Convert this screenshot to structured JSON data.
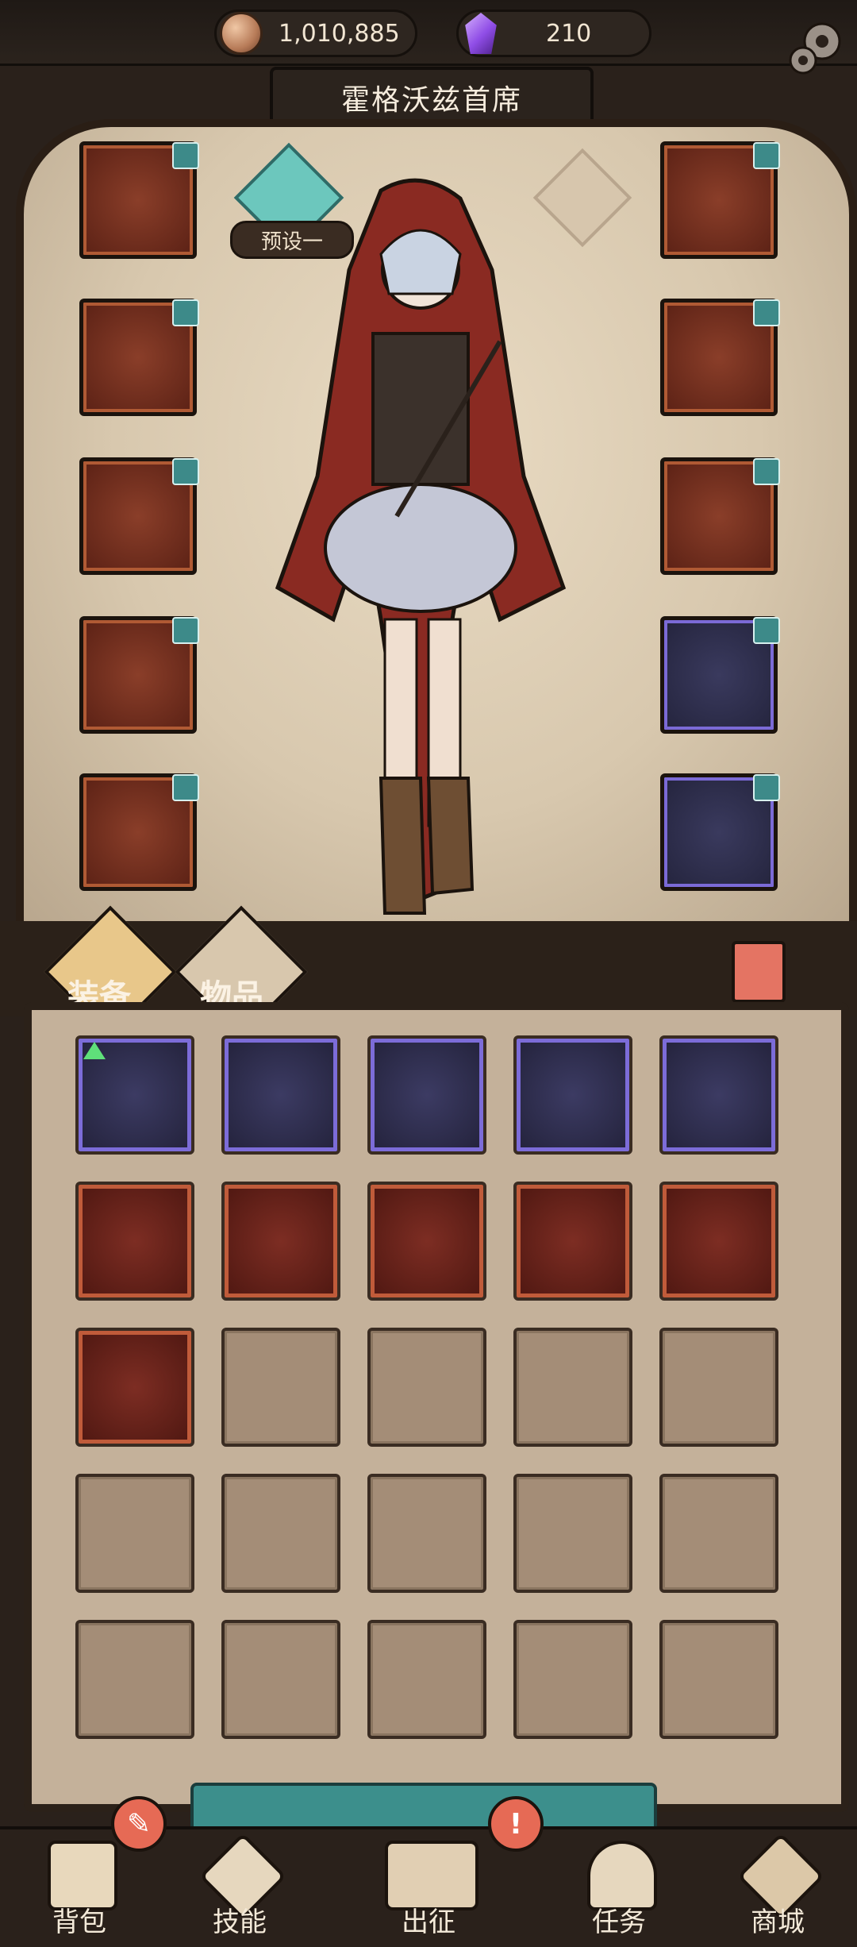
{
  "header": {
    "coins": "1,010,885",
    "gems": "210",
    "title": "霍格沃兹首席",
    "icons": {
      "coin": "coin-icon",
      "gem": "gem-icon",
      "settings": "gear-icon"
    }
  },
  "character": {
    "preset_label": "预设一"
  },
  "equipment_slots_left": [
    {
      "item": "red-hood",
      "rarity": "orange"
    },
    {
      "item": "leather-cape",
      "rarity": "orange"
    },
    {
      "item": "bandage-gloves",
      "rarity": "orange"
    },
    {
      "item": "puffy-shorts",
      "rarity": "orange"
    },
    {
      "item": "fur-boots",
      "rarity": "orange"
    }
  ],
  "equipment_slots_right": [
    {
      "item": "ruby-amulet",
      "rarity": "orange"
    },
    {
      "item": "bronze-ring",
      "rarity": "orange"
    },
    {
      "item": "ruby-ring",
      "rarity": "orange"
    },
    {
      "item": "magic-wand",
      "rarity": "purple"
    },
    {
      "item": "map-scroll",
      "rarity": "purple"
    }
  ],
  "tabs": {
    "equipment": "装备",
    "items": "物品"
  },
  "inventory": {
    "rows": [
      [
        "purple",
        "purple",
        "purple",
        "purple",
        "purple"
      ],
      [
        "red",
        "red",
        "red",
        "red",
        "red"
      ],
      [
        "red",
        "empty",
        "empty",
        "empty",
        "empty"
      ],
      [
        "empty",
        "empty",
        "empty",
        "empty",
        "empty"
      ],
      [
        "empty",
        "empty",
        "empty",
        "empty",
        "empty"
      ]
    ]
  },
  "nav": [
    {
      "label": "背包",
      "icon": "backpack-icon"
    },
    {
      "label": "技能",
      "icon": "skill-icon"
    },
    {
      "label": "出征",
      "icon": "map-icon"
    },
    {
      "label": "任务",
      "icon": "quest-icon"
    },
    {
      "label": "商城",
      "icon": "shop-icon"
    }
  ],
  "colors": {
    "accent_teal": "#3c8f8c",
    "rarity_orange": "#b05a34",
    "rarity_purple": "#7b6ad6",
    "rarity_red": "#c05b3a",
    "alert": "#e66a55"
  }
}
